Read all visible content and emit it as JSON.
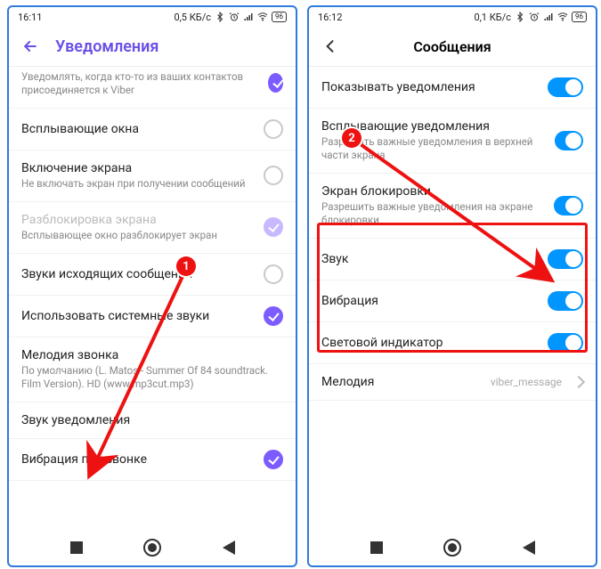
{
  "left": {
    "status": {
      "time": "16:11",
      "net": "0,5 КБ/с",
      "batt": "96"
    },
    "header": {
      "title": "Уведомления"
    },
    "rows": [
      {
        "title": "",
        "sub": "Уведомлять, когда кто-то из ваших контактов присоединяется к Viber",
        "checked": true,
        "mode": "chk"
      },
      {
        "title": "Всплывающие окна",
        "sub": "",
        "checked": false,
        "mode": "chk"
      },
      {
        "title": "Включение экрана",
        "sub": "Не включать экран при получении сообщений",
        "checked": false,
        "mode": "chk"
      },
      {
        "title": "Разблокировка экрана",
        "sub": "Всплывающее окно разблокирует экран",
        "checked": true,
        "mode": "chk",
        "disabled": true,
        "faded": true
      },
      {
        "title": "Звуки исходящих сообщений",
        "sub": "",
        "checked": false,
        "mode": "chk"
      },
      {
        "title": "Использовать системные звуки",
        "sub": "",
        "checked": true,
        "mode": "chk"
      },
      {
        "title": "Мелодия звонка",
        "sub": "По умолчанию (L. Matos - Summer Of 84 soundtrack. Film Version). HD (www.mp3cut.mp3)",
        "mode": "none"
      },
      {
        "title": "Звук уведомления",
        "sub": "",
        "mode": "none"
      },
      {
        "title": "Вибрация при звонке",
        "sub": "",
        "checked": true,
        "mode": "chk"
      }
    ]
  },
  "right": {
    "status": {
      "time": "16:12",
      "net": "0,1 КБ/с",
      "batt": "96"
    },
    "header": {
      "title": "Сообщения"
    },
    "rows": [
      {
        "title": "Показывать уведомления",
        "sub": "",
        "mode": "toggle"
      },
      {
        "title": "Всплывающие уведомления",
        "sub": "Разрешить важные уведомления в верхней части экрана",
        "mode": "toggle"
      },
      {
        "title": "Экран блокировки",
        "sub": "Разрешить важные уведомления на экране блокировки",
        "mode": "toggle"
      },
      {
        "title": "Звук",
        "sub": "",
        "mode": "toggle"
      },
      {
        "title": "Вибрация",
        "sub": "",
        "mode": "toggle"
      },
      {
        "title": "Световой индикатор",
        "sub": "",
        "mode": "toggle"
      },
      {
        "title": "Мелодия",
        "sub": "",
        "mode": "value",
        "value": "viber_message"
      }
    ]
  },
  "callouts": {
    "one": "1",
    "two": "2"
  }
}
